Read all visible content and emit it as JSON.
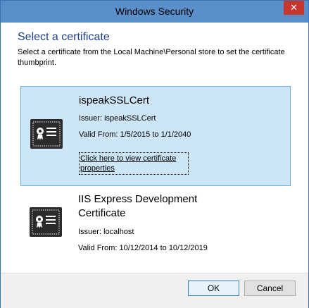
{
  "window": {
    "title": "Windows Security",
    "close_label": "✕"
  },
  "header": {
    "title": "Select a certificate",
    "description": "Select a certificate from the Local Machine\\Personal store to set the certificate thumbprint."
  },
  "certificates": [
    {
      "name": "ispeakSSLCert",
      "issuer": "Issuer: ispeakSSLCert",
      "valid": "Valid From: 1/5/2015 to 1/1/2040",
      "link": "Click here to view certificate properties",
      "selected": true
    },
    {
      "name": "IIS Express Development Certificate",
      "issuer": "Issuer: localhost",
      "valid": "Valid From: 10/12/2014 to 10/12/2019",
      "selected": false
    }
  ],
  "buttons": {
    "ok": "OK",
    "cancel": "Cancel"
  },
  "icons": {
    "certificate": "certificate-icon",
    "close": "close-icon"
  },
  "colors": {
    "titlebar": "#5b8fc9",
    "selection": "#cde6f7",
    "heading": "#1e3f8e"
  }
}
